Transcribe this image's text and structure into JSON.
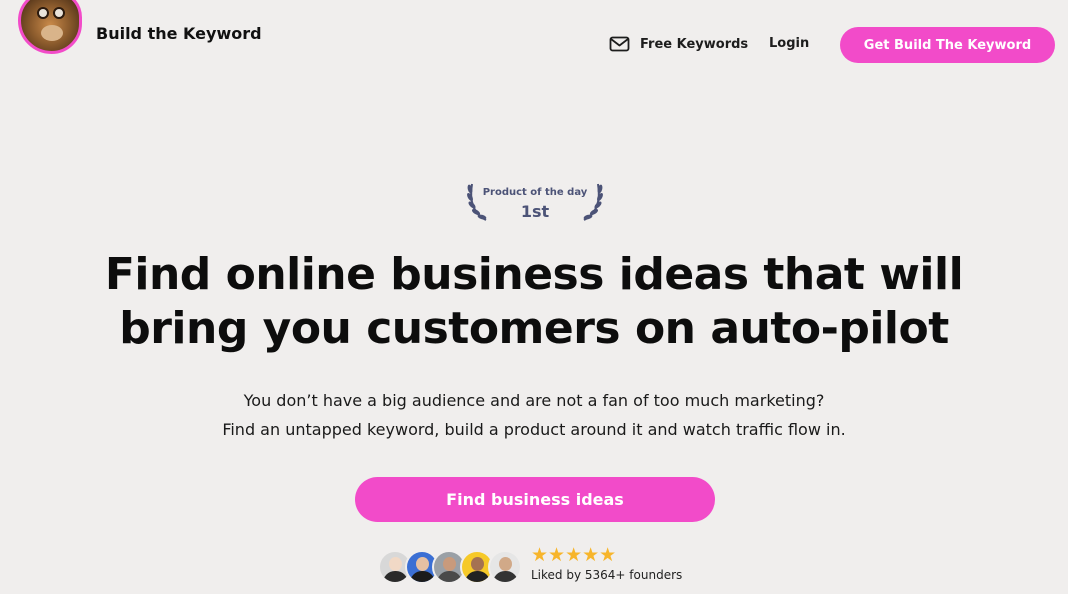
{
  "header": {
    "brand": "Build the Keyword",
    "nav_free_keywords": "Free Keywords",
    "nav_login": "Login",
    "cta": "Get Build The Keyword"
  },
  "badge": {
    "line1": "Product of the day",
    "line2": "1st"
  },
  "hero": {
    "headline_line1": "Find online business ideas that will",
    "headline_line2": "bring you customers on auto-pilot",
    "sub_line1": "You don’t have a big audience and are not a fan of too much marketing?",
    "sub_line2": "Find an untapped keyword, build a product around it and watch traffic flow in.",
    "cta": "Find business ideas"
  },
  "social": {
    "stars": "★★★★★",
    "liked": "Liked by 5364+ founders"
  },
  "colors": {
    "accent": "#f24bc9",
    "background": "#f0eeed",
    "badge": "#4c5377",
    "stars": "#f7b52b"
  },
  "icons": {
    "mail": "mail-icon",
    "laurel": "laurel-icon",
    "star": "star-icon"
  }
}
